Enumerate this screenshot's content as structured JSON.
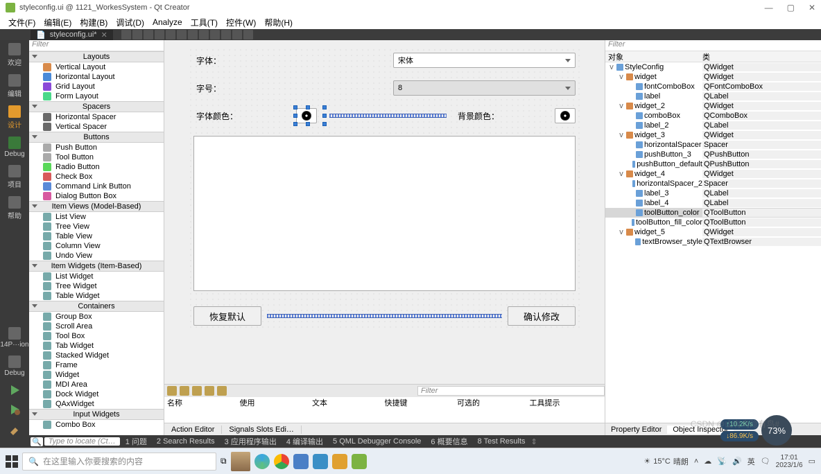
{
  "title": "styleconfig.ui @ 1121_WorkesSystem - Qt Creator",
  "menu": [
    "文件(F)",
    "编辑(E)",
    "构建(B)",
    "调试(D)",
    "Analyze",
    "工具(T)",
    "控件(W)",
    "帮助(H)"
  ],
  "tab": {
    "label": "styleconfig.ui*"
  },
  "rail": {
    "welcome": "欢迎",
    "edit": "编辑",
    "design": "设计",
    "debug": "Debug",
    "project": "项目",
    "help": "帮助",
    "14pion": "14P···ion",
    "debug2": "Debug"
  },
  "filter": "Filter",
  "widgetbox": {
    "layouts": {
      "title": "Layouts",
      "items": [
        "Vertical Layout",
        "Horizontal Layout",
        "Grid Layout",
        "Form Layout"
      ]
    },
    "spacers": {
      "title": "Spacers",
      "items": [
        "Horizontal Spacer",
        "Vertical Spacer"
      ]
    },
    "buttons": {
      "title": "Buttons",
      "items": [
        "Push Button",
        "Tool Button",
        "Radio Button",
        "Check Box",
        "Command Link Button",
        "Dialog Button Box"
      ]
    },
    "itemviews": {
      "title": "Item Views (Model-Based)",
      "items": [
        "List View",
        "Tree View",
        "Table View",
        "Column View",
        "Undo View"
      ]
    },
    "itemwidgets": {
      "title": "Item Widgets (Item-Based)",
      "items": [
        "List Widget",
        "Tree Widget",
        "Table Widget"
      ]
    },
    "containers": {
      "title": "Containers",
      "items": [
        "Group Box",
        "Scroll Area",
        "Tool Box",
        "Tab Widget",
        "Stacked Widget",
        "Frame",
        "Widget",
        "MDI Area",
        "Dock Widget",
        "QAxWidget"
      ]
    },
    "inputs": {
      "title": "Input Widgets",
      "items": [
        "Combo Box"
      ]
    }
  },
  "form": {
    "font_label": "字体：",
    "font_value": "宋体",
    "size_label": "字号：",
    "size_value": "8",
    "color_label": "字体颜色：",
    "bg_label": "背景颜色：",
    "restore_btn": "恢复默认",
    "confirm_btn": "确认修改"
  },
  "action_editor": {
    "filter": "Filter",
    "cols": [
      "名称",
      "使用",
      "文本",
      "快捷键",
      "可选的",
      "工具提示"
    ],
    "tabs": [
      "Action Editor",
      "Signals Slots Edi…"
    ]
  },
  "object_inspector": {
    "filter": "Filter",
    "cols": [
      "对象",
      "类"
    ],
    "tree": [
      {
        "depth": 0,
        "toggle": "v",
        "name": "StyleConfig",
        "cls": "QWidget",
        "icon": "w"
      },
      {
        "depth": 1,
        "toggle": "v",
        "name": "widget",
        "cls": "QWidget",
        "icon": "l"
      },
      {
        "depth": 2,
        "toggle": "",
        "name": "fontComboBox",
        "cls": "QFontComboBox",
        "icon": "w"
      },
      {
        "depth": 2,
        "toggle": "",
        "name": "label",
        "cls": "QLabel",
        "icon": "w"
      },
      {
        "depth": 1,
        "toggle": "v",
        "name": "widget_2",
        "cls": "QWidget",
        "icon": "l"
      },
      {
        "depth": 2,
        "toggle": "",
        "name": "comboBox",
        "cls": "QComboBox",
        "icon": "w"
      },
      {
        "depth": 2,
        "toggle": "",
        "name": "label_2",
        "cls": "QLabel",
        "icon": "w"
      },
      {
        "depth": 1,
        "toggle": "v",
        "name": "widget_3",
        "cls": "QWidget",
        "icon": "l"
      },
      {
        "depth": 2,
        "toggle": "",
        "name": "horizontalSpacer",
        "cls": "Spacer",
        "icon": "w"
      },
      {
        "depth": 2,
        "toggle": "",
        "name": "pushButton_3",
        "cls": "QPushButton",
        "icon": "w"
      },
      {
        "depth": 2,
        "toggle": "",
        "name": "pushButton_default",
        "cls": "QPushButton",
        "icon": "w"
      },
      {
        "depth": 1,
        "toggle": "v",
        "name": "widget_4",
        "cls": "QWidget",
        "icon": "l"
      },
      {
        "depth": 2,
        "toggle": "",
        "name": "horizontalSpacer_2",
        "cls": "Spacer",
        "icon": "w"
      },
      {
        "depth": 2,
        "toggle": "",
        "name": "label_3",
        "cls": "QLabel",
        "icon": "w"
      },
      {
        "depth": 2,
        "toggle": "",
        "name": "label_4",
        "cls": "QLabel",
        "icon": "w"
      },
      {
        "depth": 2,
        "toggle": "",
        "name": "toolButton_color",
        "cls": "QToolButton",
        "icon": "w",
        "sel": true
      },
      {
        "depth": 2,
        "toggle": "",
        "name": "toolButton_fill_color",
        "cls": "QToolButton",
        "icon": "w"
      },
      {
        "depth": 1,
        "toggle": "v",
        "name": "widget_5",
        "cls": "QWidget",
        "icon": "l"
      },
      {
        "depth": 2,
        "toggle": "",
        "name": "textBrowser_style",
        "cls": "QTextBrowser",
        "icon": "w"
      }
    ],
    "tabs": [
      "Property Editor",
      "Object Inspector"
    ]
  },
  "status": {
    "locate": "Type to locate (Ct…",
    "tabs": [
      "1 问题",
      "2 Search Results",
      "3 应用程序输出",
      "4 编译输出",
      "5 QML Debugger Console",
      "6 概要信息",
      "8 Test Results"
    ]
  },
  "taskbar": {
    "search": "在这里输入你要搜索的内容",
    "weather_temp": "15°C",
    "weather_cond": "晴朗",
    "net_up": "↑10.2K/s",
    "net_down": "↓86.9K/s",
    "net_pct": "73%",
    "ime": "英",
    "time": "17:01",
    "date": "2023/1/6"
  },
  "watermark": "CSDN @山有鸟隐有鸟#"
}
